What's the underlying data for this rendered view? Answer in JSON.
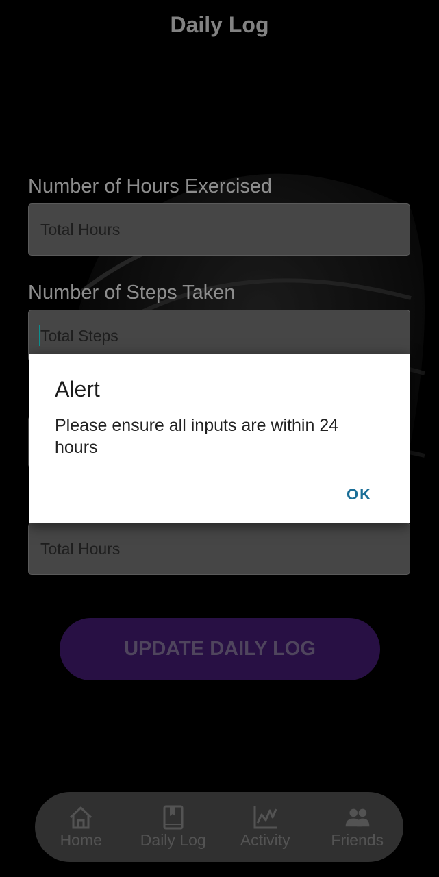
{
  "header": {
    "title": "Daily Log"
  },
  "form": {
    "hours_label": "Number of Hours Exercised",
    "hours_placeholder": "Total Hours",
    "steps_label": "Number of Steps Taken",
    "steps_placeholder": "Total Steps",
    "third_placeholder": "",
    "fourth_placeholder": "Total Hours",
    "update_label": "UPDATE DAILY LOG"
  },
  "nav": {
    "items": [
      {
        "label": "Home",
        "icon": "home-icon"
      },
      {
        "label": "Daily Log",
        "icon": "book-icon"
      },
      {
        "label": "Activity",
        "icon": "chart-icon"
      },
      {
        "label": "Friends",
        "icon": "people-icon"
      }
    ]
  },
  "dialog": {
    "title": "Alert",
    "message": "Please ensure all inputs are within 24 hours",
    "ok_label": "OK"
  },
  "colors": {
    "accent_button": "#3e1a69",
    "ok_text": "#1a6e97",
    "caret": "#0b8f8f"
  }
}
